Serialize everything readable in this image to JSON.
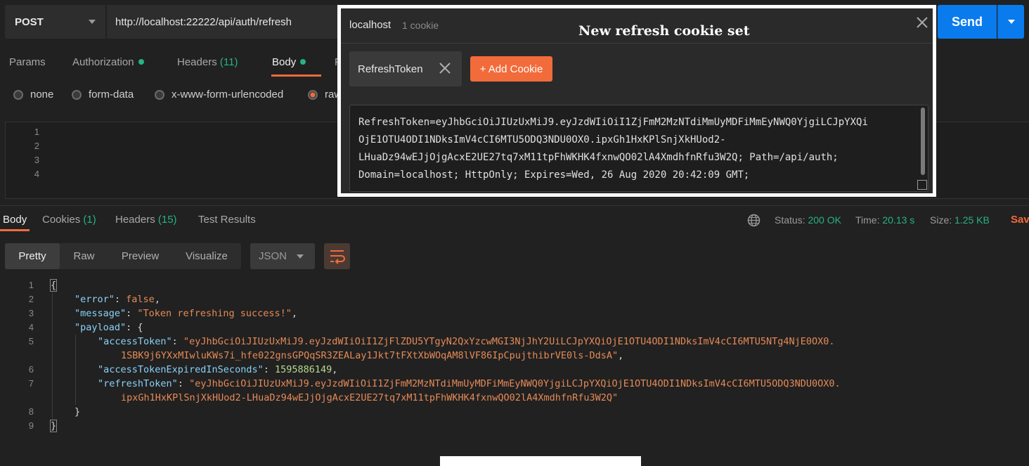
{
  "request": {
    "method": "POST",
    "url": "http://localhost:22222/api/auth/refresh",
    "send_label": "Send"
  },
  "request_tabs": {
    "params": "Params",
    "authorization": "Authorization",
    "headers": "Headers",
    "headers_count": "(11)",
    "body": "Body",
    "cut_letter": "P"
  },
  "body_types": {
    "none": "none",
    "form_data": "form-data",
    "urlencoded": "x-www-form-urlencoded",
    "raw": "raw"
  },
  "editor": {
    "line_numbers": [
      "1",
      "2",
      "3",
      "4"
    ]
  },
  "response_tabs": {
    "body": "Body",
    "cookies": "Cookies",
    "cookies_count": "(1)",
    "headers": "Headers",
    "headers_count": "(15)",
    "test_results": "Test Results"
  },
  "response_meta": {
    "status_label": "Status:",
    "status_value": "200 OK",
    "time_label": "Time:",
    "time_value": "20.13 s",
    "size_label": "Size:",
    "size_value": "1.25 KB",
    "save_label": "Sav"
  },
  "response_toolbar": {
    "pretty": "Pretty",
    "raw": "Raw",
    "preview": "Preview",
    "visualize": "Visualize",
    "format": "JSON"
  },
  "response_body": {
    "line_numbers": [
      "1",
      "2",
      "3",
      "4",
      "5",
      "6",
      "7",
      "8",
      "9"
    ],
    "open_brace": "{",
    "error_key": "\"error\"",
    "error_value": "false",
    "message_key": "\"message\"",
    "message_value": "\"Token refreshing success!\"",
    "payload_key": "\"payload\"",
    "access_token_key": "\"accessToken\"",
    "access_token_value_1": "\"eyJhbGciOiJIUzUxMiJ9.eyJzdWIiOiI1ZjFlZDU5YTgyN2QxYzcwMGI3NjJhY2UiLCJpYXQiOjE1OTU4ODI1NDksImV4cCI6MTU5NTg4NjE0OX0.",
    "access_token_value_2": "1SBK9j6YXxMIwluKWs7i_hfe022gnsGPQqSR3ZEALay1Jkt7tFXtXbWOqAM8lVF86IpCpujthibrVE0ls-DdsA\"",
    "expired_key": "\"accessTokenExpiredInSeconds\"",
    "expired_value": "1595886149",
    "refresh_token_key": "\"refreshToken\"",
    "refresh_token_value_1": "\"eyJhbGciOiJIUzUxMiJ9.eyJzdWIiOiI1ZjFmM2MzNTdiMmUyMDFiMmEyNWQ0YjgiLCJpYXQiOjE1OTU4ODI1NDksImV4cCI6MTU5ODQ3NDU0OX0.",
    "refresh_token_value_2": "ipxGh1HxKPlSnjXkHUod2-LHuaDz94wEJjOjgAcxE2UE27tq7xM11tpFhWKHK4fxnwQO02lA4XmdhfnRfu3W2Q\"",
    "close_inner": "}",
    "close_brace": "}"
  },
  "cookie_popup": {
    "host": "localhost",
    "count": "1 cookie",
    "annotation": "New refresh cookie set",
    "cookie_name": "RefreshToken",
    "add_cookie_label": "+ Add Cookie",
    "cookie_lines": [
      "RefreshToken=eyJhbGciOiJIUzUxMiJ9.eyJzdWIiOiI1ZjFmM2MzNTdiMmUyMDFiMmEyNWQ0YjgiLCJpYXQi",
      "OjE1OTU4ODI1NDksImV4cCI6MTU5ODQ3NDU0OX0.ipxGh1HxKPlSnjXkHUod2-",
      "LHuaDz94wEJjOjgAcxE2UE27tq7xM11tpFhWKHK4fxnwQO02lA4XmdhfnRfu3W2Q; Path=/api/auth;",
      "Domain=localhost; HttpOnly; Expires=Wed, 26 Aug 2020 20:42:09 GMT;"
    ]
  },
  "colors": {
    "accent": "#f26b3a",
    "send": "#097bed",
    "success": "#26b47f"
  }
}
